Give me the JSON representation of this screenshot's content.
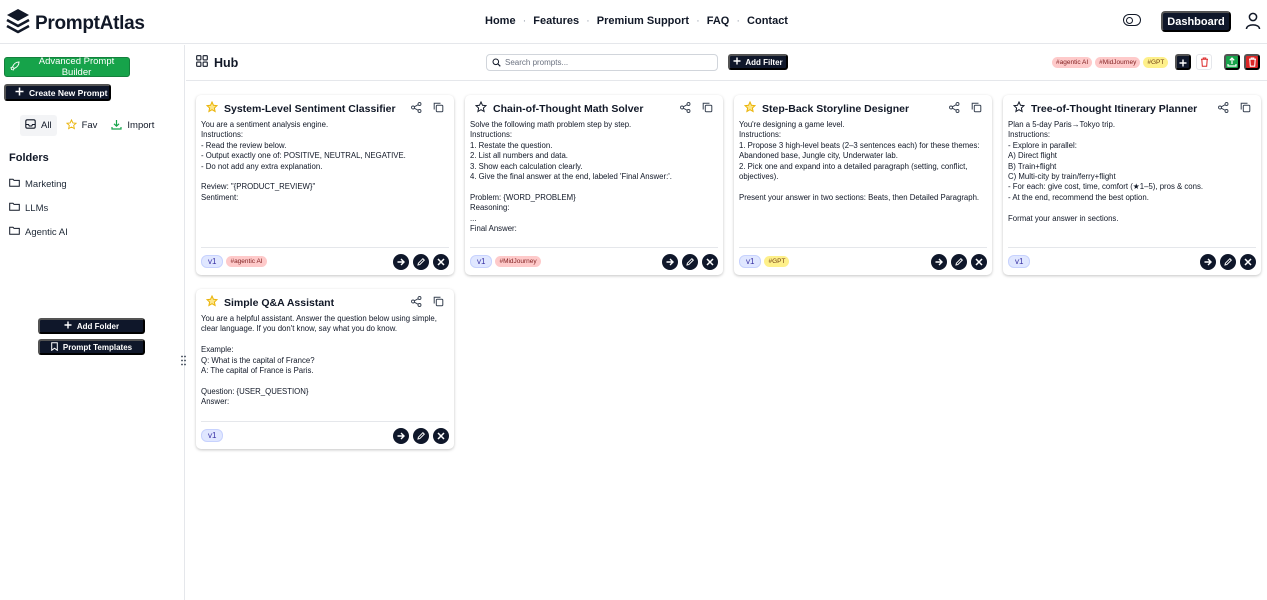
{
  "app": {
    "name": "PromptAtlas"
  },
  "nav": {
    "links": [
      "Home",
      "Features",
      "Premium Support",
      "FAQ",
      "Contact"
    ],
    "separator": "·",
    "dashboard_label": "Dashboard"
  },
  "sidebar": {
    "advanced_builder_label": "Advanced Prompt Builder",
    "create_prompt_label": "Create New Prompt",
    "filters": {
      "all": "All",
      "fav": "Fav",
      "import": "Import"
    },
    "folders_title": "Folders",
    "folders": [
      "Marketing",
      "LLMs",
      "Agentic AI"
    ],
    "add_folder_label": "Add Folder",
    "prompt_templates_label": "Prompt Templates"
  },
  "toolbar": {
    "title": "Hub",
    "search_placeholder": "Search prompts...",
    "add_filter_label": "Add Filter",
    "tags": [
      "#agentic AI",
      "#MidJourney",
      "#GPT"
    ]
  },
  "colors": {
    "dark": "#0f172a",
    "green": "#16a34a",
    "red": "#dc2626",
    "star": "#eab308"
  },
  "cards": [
    {
      "title": "System-Level Sentiment Classifier",
      "starred": true,
      "body": "You are a sentiment analysis engine.\nInstructions:\n- Read the review below.\n- Output exactly one of: POSITIVE, NEUTRAL, NEGATIVE.\n- Do not add any extra explanation.\n\nReview: \"{PRODUCT_REVIEW}\"\nSentiment:",
      "version": "v1",
      "tag": "#agentic AI"
    },
    {
      "title": "Chain-of-Thought Math Solver",
      "starred": false,
      "body": "Solve the following math problem step by step.\nInstructions:\n1. Restate the question.\n2. List all numbers and data.\n3. Show each calculation clearly.\n4. Give the final answer at the end, labeled 'Final Answer:'.\n\nProblem: {WORD_PROBLEM}\nReasoning:\n...\nFinal Answer:",
      "version": "v1",
      "tag": "#MidJourney"
    },
    {
      "title": "Step-Back Storyline Designer",
      "starred": true,
      "body": "You're designing a game level.\nInstructions:\n1. Propose 3 high-level beats (2–3 sentences each) for these themes:\nAbandoned base, Jungle city, Underwater lab.\n2. Pick one and expand into a detailed paragraph (setting, conflict,\nobjectives).\n\nPresent your answer in two sections: Beats, then Detailed Paragraph.",
      "version": "v1",
      "tag": "#GPT"
    },
    {
      "title": "Tree-of-Thought Itinerary Planner",
      "starred": false,
      "body": "Plan a 5-day Paris→Tokyo trip.\nInstructions:\n- Explore in parallel:\n  A) Direct flight\n  B) Train+flight\n  C) Multi-city by train/ferry+flight\n- For each: give cost, time, comfort (★1–5), pros & cons.\n- At the end, recommend the best option.\n\nFormat your answer in sections.",
      "version": "v1",
      "tag": ""
    },
    {
      "title": "Simple Q&A Assistant",
      "starred": true,
      "body": "You are a helpful assistant. Answer the question below using simple,\nclear language. If you don't know, say what you do know.\n\nExample:\nQ: What is the capital of France?\nA: The capital of France is Paris.\n\nQuestion: {USER_QUESTION}\nAnswer:",
      "version": "v1",
      "tag": ""
    }
  ]
}
